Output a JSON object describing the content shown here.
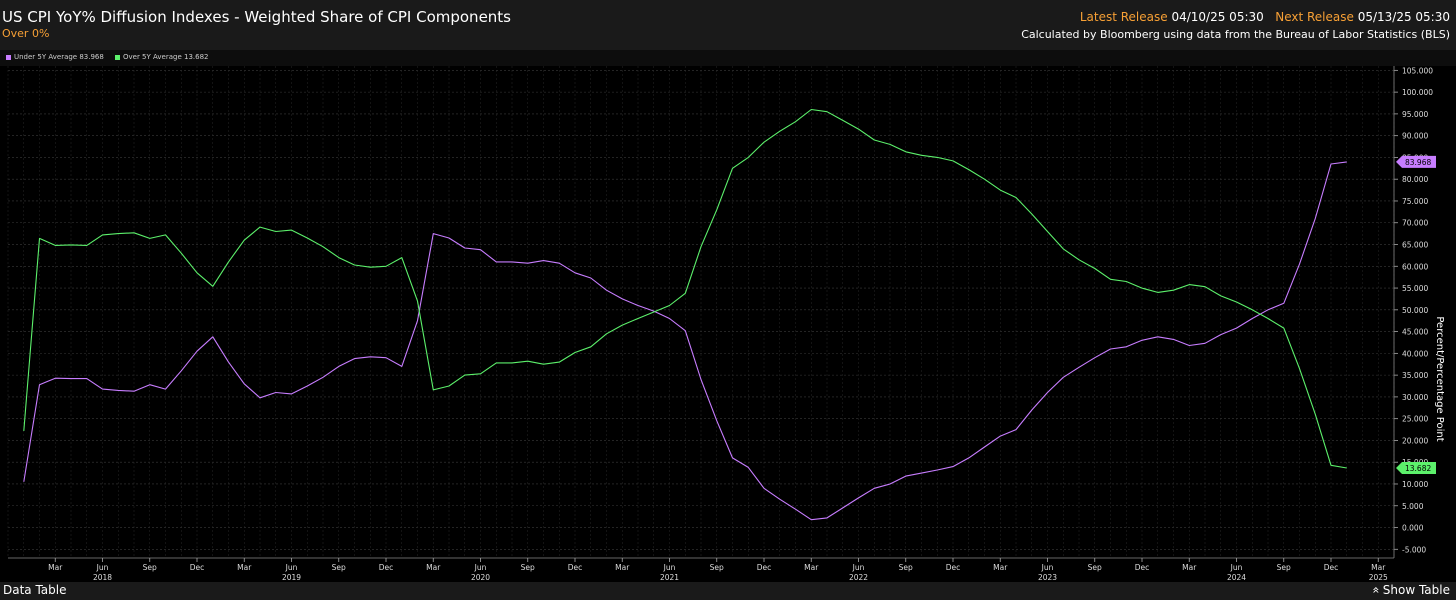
{
  "header": {
    "title": "US CPI YoY% Diffusion Indexes - Weighted Share of CPI Components",
    "subtitle": "Over 0%",
    "latest_release_label": "Latest Release",
    "latest_release_value": "04/10/25 05:30",
    "next_release_label": "Next Release",
    "next_release_value": "05/13/25 05:30",
    "source_note": "Calculated by Bloomberg using data from the Bureau of Labor Statistics (BLS)"
  },
  "legend": [
    {
      "label": "Under 5Y Average 83.968",
      "color": "#c77dff"
    },
    {
      "label": "Over 5Y Average 13.682",
      "color": "#5cf06b"
    }
  ],
  "footer": {
    "data_table_label": "Data Table",
    "show_table_label": "Show Table"
  },
  "chart_data": {
    "type": "line",
    "y_axis_label": "Percent/Percentage Point",
    "y_axis_side": "right",
    "ylim": [
      -7,
      106
    ],
    "y_ticks": [
      -5,
      0,
      5,
      10,
      15,
      20,
      25,
      30,
      35,
      40,
      45,
      50,
      55,
      60,
      65,
      70,
      75,
      80,
      85,
      90,
      95,
      100,
      105
    ],
    "grid": true,
    "x_range": [
      "2017-12",
      "2025-04"
    ],
    "x_ticks": [
      {
        "date": "2018-03",
        "label": "Mar"
      },
      {
        "date": "2018-06",
        "label": "Jun",
        "year": "2018"
      },
      {
        "date": "2018-09",
        "label": "Sep"
      },
      {
        "date": "2018-12",
        "label": "Dec"
      },
      {
        "date": "2019-03",
        "label": "Mar"
      },
      {
        "date": "2019-06",
        "label": "Jun",
        "year": "2019"
      },
      {
        "date": "2019-09",
        "label": "Sep"
      },
      {
        "date": "2019-12",
        "label": "Dec"
      },
      {
        "date": "2020-03",
        "label": "Mar"
      },
      {
        "date": "2020-06",
        "label": "Jun",
        "year": "2020"
      },
      {
        "date": "2020-09",
        "label": "Sep"
      },
      {
        "date": "2020-12",
        "label": "Dec"
      },
      {
        "date": "2021-03",
        "label": "Mar"
      },
      {
        "date": "2021-06",
        "label": "Jun",
        "year": "2021"
      },
      {
        "date": "2021-09",
        "label": "Sep"
      },
      {
        "date": "2021-12",
        "label": "Dec"
      },
      {
        "date": "2022-03",
        "label": "Mar"
      },
      {
        "date": "2022-06",
        "label": "Jun",
        "year": "2022"
      },
      {
        "date": "2022-09",
        "label": "Sep"
      },
      {
        "date": "2022-12",
        "label": "Dec"
      },
      {
        "date": "2023-03",
        "label": "Mar"
      },
      {
        "date": "2023-06",
        "label": "Jun",
        "year": "2023"
      },
      {
        "date": "2023-09",
        "label": "Sep"
      },
      {
        "date": "2023-12",
        "label": "Dec"
      },
      {
        "date": "2024-03",
        "label": "Mar"
      },
      {
        "date": "2024-06",
        "label": "Jun",
        "year": "2024"
      },
      {
        "date": "2024-09",
        "label": "Sep"
      },
      {
        "date": "2024-12",
        "label": "Dec"
      },
      {
        "date": "2025-03",
        "label": "Mar",
        "year": "2025"
      }
    ],
    "series": [
      {
        "name": "Under 5Y Average",
        "last_value_label": "83.968",
        "color": "#c77dff",
        "points": [
          [
            "2018-01",
            10.5
          ],
          [
            "2018-02",
            32.8
          ],
          [
            "2018-03",
            34.3
          ],
          [
            "2018-04",
            34.2
          ],
          [
            "2018-05",
            34.2
          ],
          [
            "2018-06",
            31.8
          ],
          [
            "2018-07",
            31.5
          ],
          [
            "2018-08",
            31.3
          ],
          [
            "2018-09",
            32.8
          ],
          [
            "2018-10",
            31.8
          ],
          [
            "2018-11",
            36.0
          ],
          [
            "2018-12",
            40.5
          ],
          [
            "2019-01",
            43.8
          ],
          [
            "2019-02",
            38.0
          ],
          [
            "2019-03",
            33.0
          ],
          [
            "2019-04",
            29.8
          ],
          [
            "2019-05",
            31.0
          ],
          [
            "2019-06",
            30.7
          ],
          [
            "2019-07",
            32.5
          ],
          [
            "2019-08",
            34.5
          ],
          [
            "2019-09",
            37.0
          ],
          [
            "2019-10",
            38.8
          ],
          [
            "2019-11",
            39.2
          ],
          [
            "2019-12",
            39.0
          ],
          [
            "2020-01",
            37.0
          ],
          [
            "2020-02",
            47.5
          ],
          [
            "2020-03",
            67.5
          ],
          [
            "2020-04",
            66.5
          ],
          [
            "2020-05",
            64.2
          ],
          [
            "2020-06",
            63.8
          ],
          [
            "2020-07",
            61.0
          ],
          [
            "2020-08",
            61.0
          ],
          [
            "2020-09",
            60.7
          ],
          [
            "2020-10",
            61.3
          ],
          [
            "2020-11",
            60.7
          ],
          [
            "2020-12",
            58.5
          ],
          [
            "2021-01",
            57.3
          ],
          [
            "2021-02",
            54.5
          ],
          [
            "2021-03",
            52.5
          ],
          [
            "2021-04",
            51.0
          ],
          [
            "2021-05",
            49.7
          ],
          [
            "2021-06",
            48.0
          ],
          [
            "2021-07",
            45.2
          ],
          [
            "2021-08",
            34.0
          ],
          [
            "2021-09",
            24.5
          ],
          [
            "2021-10",
            16.0
          ],
          [
            "2021-11",
            13.8
          ],
          [
            "2021-12",
            9.0
          ],
          [
            "2022-01",
            6.5
          ],
          [
            "2022-02",
            4.2
          ],
          [
            "2022-03",
            1.8
          ],
          [
            "2022-04",
            2.2
          ],
          [
            "2022-05",
            4.5
          ],
          [
            "2022-06",
            6.8
          ],
          [
            "2022-07",
            9.0
          ],
          [
            "2022-08",
            10.0
          ],
          [
            "2022-09",
            11.8
          ],
          [
            "2022-10",
            12.5
          ],
          [
            "2022-11",
            13.2
          ],
          [
            "2022-12",
            14.0
          ],
          [
            "2023-01",
            16.0
          ],
          [
            "2023-02",
            18.5
          ],
          [
            "2023-03",
            21.0
          ],
          [
            "2023-04",
            22.5
          ],
          [
            "2023-05",
            27.0
          ],
          [
            "2023-06",
            31.0
          ],
          [
            "2023-07",
            34.5
          ],
          [
            "2023-08",
            36.8
          ],
          [
            "2023-09",
            39.0
          ],
          [
            "2023-10",
            41.0
          ],
          [
            "2023-11",
            41.5
          ],
          [
            "2023-12",
            43.0
          ],
          [
            "2024-01",
            43.8
          ],
          [
            "2024-02",
            43.2
          ],
          [
            "2024-03",
            41.8
          ],
          [
            "2024-04",
            42.3
          ],
          [
            "2024-05",
            44.3
          ],
          [
            "2024-06",
            45.8
          ],
          [
            "2024-07",
            48.0
          ],
          [
            "2024-08",
            50.0
          ],
          [
            "2024-09",
            51.5
          ],
          [
            "2024-10",
            60.5
          ],
          [
            "2024-11",
            71.0
          ],
          [
            "2024-12",
            83.5
          ],
          [
            "2025-01",
            83.968
          ]
        ]
      },
      {
        "name": "Over 5Y Average",
        "last_value_label": "13.682",
        "color": "#5cf06b",
        "points": [
          [
            "2018-01",
            22.2
          ],
          [
            "2018-02",
            66.4
          ],
          [
            "2018-03",
            64.8
          ],
          [
            "2018-04",
            64.9
          ],
          [
            "2018-05",
            64.8
          ],
          [
            "2018-06",
            67.2
          ],
          [
            "2018-07",
            67.5
          ],
          [
            "2018-08",
            67.7
          ],
          [
            "2018-09",
            66.4
          ],
          [
            "2018-10",
            67.2
          ],
          [
            "2018-11",
            63.0
          ],
          [
            "2018-12",
            58.5
          ],
          [
            "2019-01",
            55.4
          ],
          [
            "2019-02",
            61.0
          ],
          [
            "2019-03",
            66.0
          ],
          [
            "2019-04",
            69.0
          ],
          [
            "2019-05",
            68.0
          ],
          [
            "2019-06",
            68.3
          ],
          [
            "2019-07",
            66.5
          ],
          [
            "2019-08",
            64.5
          ],
          [
            "2019-09",
            62.0
          ],
          [
            "2019-10",
            60.3
          ],
          [
            "2019-11",
            59.8
          ],
          [
            "2019-12",
            60.0
          ],
          [
            "2020-01",
            62.0
          ],
          [
            "2020-02",
            52.0
          ],
          [
            "2020-03",
            31.6
          ],
          [
            "2020-04",
            32.5
          ],
          [
            "2020-05",
            35.0
          ],
          [
            "2020-06",
            35.3
          ],
          [
            "2020-07",
            37.8
          ],
          [
            "2020-08",
            37.8
          ],
          [
            "2020-09",
            38.2
          ],
          [
            "2020-10",
            37.5
          ],
          [
            "2020-11",
            38.0
          ],
          [
            "2020-12",
            40.2
          ],
          [
            "2021-01",
            41.5
          ],
          [
            "2021-02",
            44.5
          ],
          [
            "2021-03",
            46.5
          ],
          [
            "2021-04",
            48.0
          ],
          [
            "2021-05",
            49.5
          ],
          [
            "2021-06",
            51.0
          ],
          [
            "2021-07",
            53.8
          ],
          [
            "2021-08",
            64.5
          ],
          [
            "2021-09",
            73.0
          ],
          [
            "2021-10",
            82.5
          ],
          [
            "2021-11",
            85.0
          ],
          [
            "2021-12",
            88.5
          ],
          [
            "2022-01",
            91.0
          ],
          [
            "2022-02",
            93.2
          ],
          [
            "2022-03",
            96.0
          ],
          [
            "2022-04",
            95.5
          ],
          [
            "2022-05",
            93.5
          ],
          [
            "2022-06",
            91.5
          ],
          [
            "2022-07",
            89.0
          ],
          [
            "2022-08",
            88.0
          ],
          [
            "2022-09",
            86.3
          ],
          [
            "2022-10",
            85.5
          ],
          [
            "2022-11",
            85.0
          ],
          [
            "2022-12",
            84.2
          ],
          [
            "2023-01",
            82.2
          ],
          [
            "2023-02",
            80.0
          ],
          [
            "2023-03",
            77.5
          ],
          [
            "2023-04",
            75.8
          ],
          [
            "2023-05",
            72.0
          ],
          [
            "2023-06",
            68.0
          ],
          [
            "2023-07",
            64.0
          ],
          [
            "2023-08",
            61.5
          ],
          [
            "2023-09",
            59.5
          ],
          [
            "2023-10",
            57.0
          ],
          [
            "2023-11",
            56.5
          ],
          [
            "2023-12",
            55.0
          ],
          [
            "2024-01",
            54.0
          ],
          [
            "2024-02",
            54.5
          ],
          [
            "2024-03",
            55.8
          ],
          [
            "2024-04",
            55.3
          ],
          [
            "2024-05",
            53.2
          ],
          [
            "2024-06",
            51.8
          ],
          [
            "2024-07",
            50.0
          ],
          [
            "2024-08",
            48.0
          ],
          [
            "2024-09",
            45.8
          ],
          [
            "2024-10",
            36.5
          ],
          [
            "2024-11",
            26.0
          ],
          [
            "2024-12",
            14.3
          ],
          [
            "2025-01",
            13.682
          ]
        ]
      }
    ]
  }
}
